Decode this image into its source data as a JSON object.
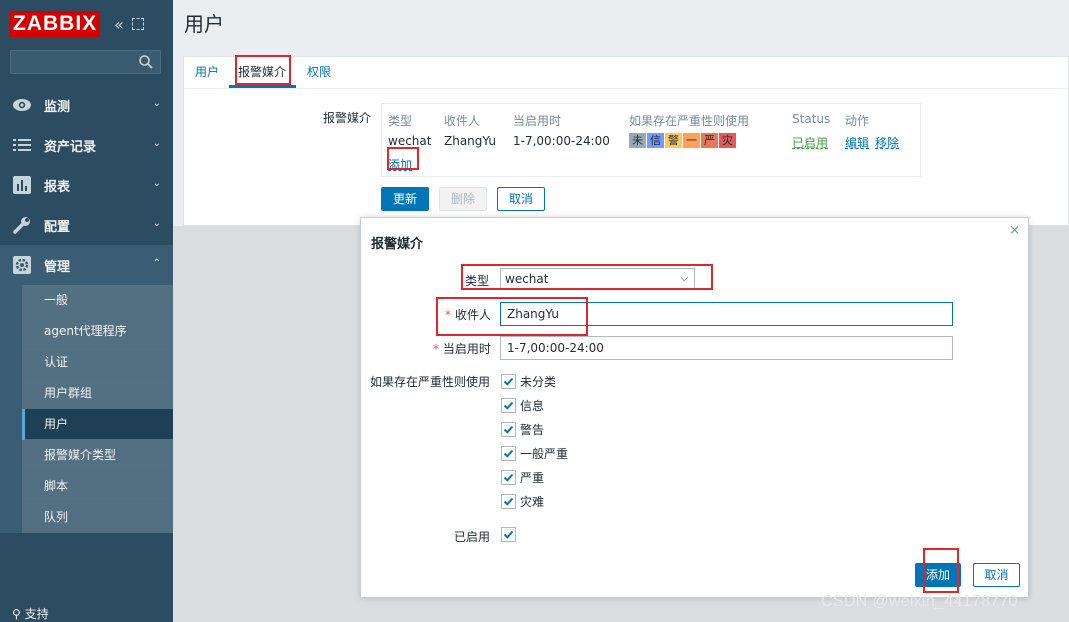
{
  "app": {
    "logo": "ZABBIX",
    "collapse_icon": "double-chevron-left-icon",
    "kiosk_icon": "expand-icon"
  },
  "sidebar": {
    "search_placeholder": "",
    "menu": [
      {
        "label": "监测",
        "icon": "eye-icon"
      },
      {
        "label": "资产记录",
        "icon": "list-icon"
      },
      {
        "label": "报表",
        "icon": "bar-chart-icon"
      },
      {
        "label": "配置",
        "icon": "wrench-icon"
      },
      {
        "label": "管理",
        "icon": "gear-icon"
      }
    ],
    "submenu": [
      "一般",
      "agent代理程序",
      "认证",
      "用户群组",
      "用户",
      "报警媒介类型",
      "脚本",
      "队列"
    ],
    "support_label": "支持"
  },
  "page": {
    "title": "用户",
    "tabs": [
      "用户",
      "报警媒介",
      "权限"
    ],
    "media_label": "报警媒介",
    "table": {
      "headers": [
        "类型",
        "收件人",
        "当启用时",
        "如果存在严重性则使用",
        "Status",
        "动作"
      ],
      "row": {
        "type": "wechat",
        "recipient": "ZhangYu",
        "when_active": "1-7,00:00-24:00",
        "severities": [
          "未",
          "信",
          "警",
          "一",
          "严",
          "灾"
        ],
        "status": "已启用",
        "edit": "编辑",
        "remove": "移除"
      },
      "add_link": "添加"
    },
    "buttons": {
      "update": "更新",
      "delete": "删除",
      "cancel": "取消"
    }
  },
  "dialog": {
    "title": "报警媒介",
    "close": "×",
    "type_label": "类型",
    "type_value": "wechat",
    "recipient_label": "收件人",
    "recipient_value": "ZhangYu",
    "when_label": "当启用时",
    "when_value": "1-7,00:00-24:00",
    "severity_label": "如果存在严重性则使用",
    "severities": [
      "未分类",
      "信息",
      "警告",
      "一般严重",
      "严重",
      "灾难"
    ],
    "enabled_label": "已启用",
    "add_button": "添加",
    "cancel_button": "取消"
  },
  "colors": {
    "sidebar_bg": "#2b4c61",
    "accent": "#0275b8",
    "highlight_box": "#e0262b",
    "severity": [
      "#97aab3",
      "#7499ff",
      "#ffc859",
      "#ffa059",
      "#e97659",
      "#e45959"
    ]
  },
  "watermark": "CSDN @weixin_44178770"
}
